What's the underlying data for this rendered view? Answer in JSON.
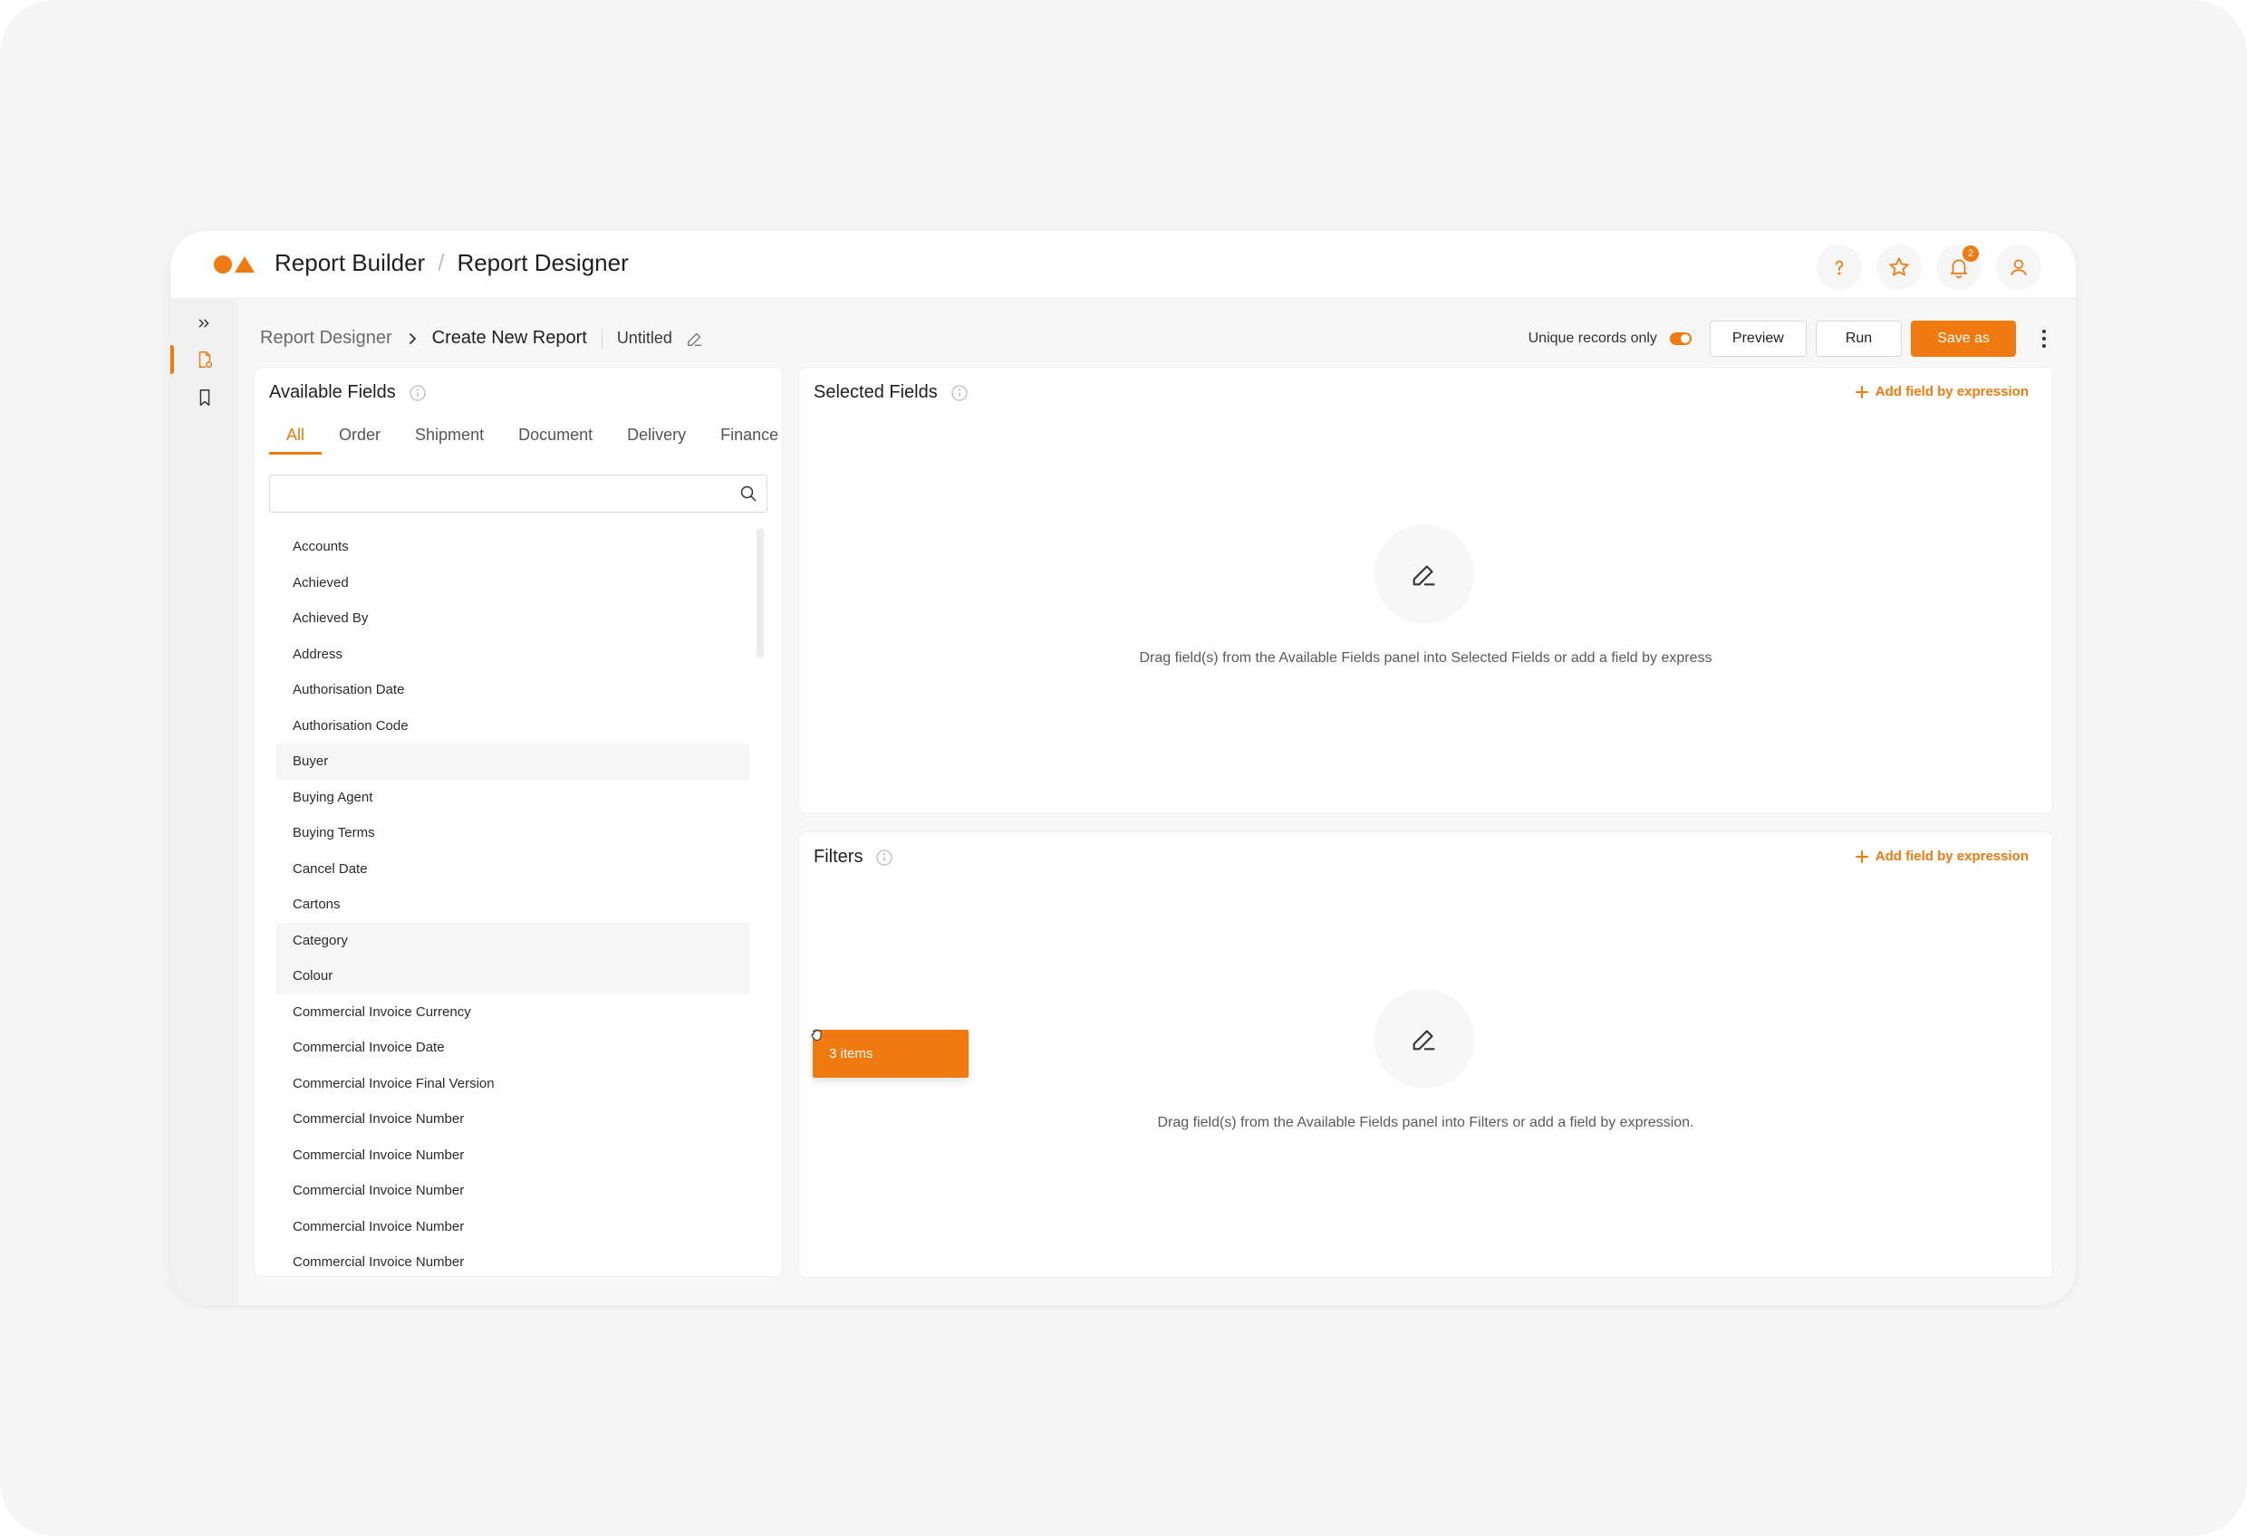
{
  "header": {
    "app_name": "Report Builder",
    "separator": "/",
    "page_name": "Report Designer",
    "notification_count": "2"
  },
  "breadcrumb": {
    "root": "Report Designer",
    "current": "Create New Report",
    "report_name": "Untitled"
  },
  "toolbar": {
    "unique_label": "Unique records only",
    "preview_label": "Preview",
    "run_label": "Run",
    "save_label": "Save as"
  },
  "available_fields": {
    "title": "Available Fields",
    "tabs": [
      {
        "label": "All",
        "active": true
      },
      {
        "label": "Order"
      },
      {
        "label": "Shipment"
      },
      {
        "label": "Document"
      },
      {
        "label": "Delivery"
      },
      {
        "label": "Finance"
      }
    ],
    "search_placeholder": "",
    "items": [
      "Accounts",
      "Achieved",
      "Achieved By",
      "Address",
      "Authorisation Date",
      "Authorisation Code",
      "Buyer",
      "Buying Agent",
      "Buying Terms",
      "Cancel Date",
      "Cartons",
      "Category",
      "Colour",
      "Commercial Invoice Currency",
      "Commercial Invoice Date",
      "Commercial Invoice Final Version",
      "Commercial Invoice Number",
      "Commercial Invoice Number",
      "Commercial Invoice Number",
      "Commercial Invoice Number",
      "Commercial Invoice Number"
    ],
    "selected_indices": [
      6,
      11,
      12
    ]
  },
  "drag": {
    "label": "3 items"
  },
  "selected_fields": {
    "title": "Selected Fields",
    "add_label": "Add field by expression",
    "empty_text": "Drag field(s) from the Available Fields panel into Selected Fields or add a field by express"
  },
  "filters": {
    "title": "Filters",
    "add_label": "Add field by expression",
    "empty_text": "Drag field(s) from the Available Fields panel into Filters or add a field by expression."
  },
  "colors": {
    "accent": "#ef7a0f"
  }
}
